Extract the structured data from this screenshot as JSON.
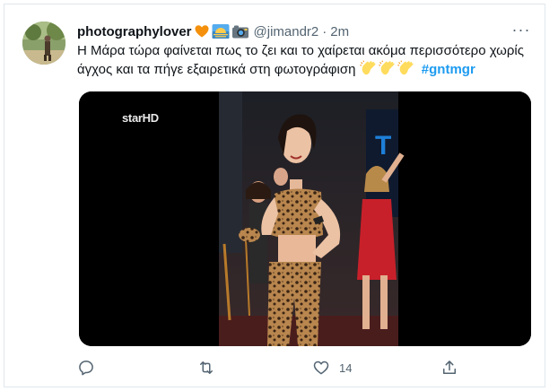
{
  "tweet": {
    "display_name": "photographylover",
    "name_emojis": [
      "orange-heart",
      "sunrise",
      "camera-with-flash"
    ],
    "handle": "@jimandr2",
    "separator": "·",
    "time": "2m",
    "more_label": "···",
    "text": "Η Μάρα τώρα φαίνεται πως το ζει και το χαίρεται ακόμα περισσότερο χωρίς άγχος και τα πήγε εξαιρετικά στη φωτογράφιση",
    "clap_emoji_count": 3,
    "hashtag": "#gntmgr",
    "media": {
      "type": "image",
      "watermark": "starHD"
    },
    "actions": {
      "reply_count": "",
      "retweet_count": "",
      "like_count": "14",
      "share_count": ""
    }
  },
  "colors": {
    "text": "#0f1419",
    "secondary_text": "#536471",
    "link": "#1d9bf0",
    "border": "#e1e8ed",
    "media_background": "#000000"
  }
}
